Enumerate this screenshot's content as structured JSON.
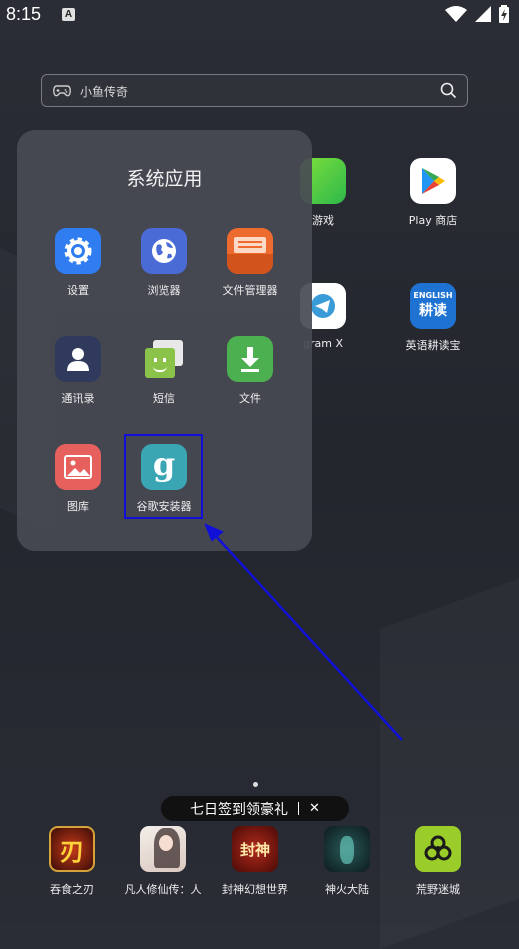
{
  "status_bar": {
    "time": "8:15",
    "notification_letter": "A"
  },
  "search": {
    "placeholder": "小鱼传奇"
  },
  "background_apps": [
    {
      "label": "游戏"
    },
    {
      "label": "Play 商店"
    },
    {
      "label": "gram X"
    },
    {
      "label": "英语耕读宝",
      "icon_line1": "ENGLISH",
      "icon_line2": "耕读"
    }
  ],
  "folder": {
    "title": "系统应用",
    "apps": [
      {
        "label": "设置"
      },
      {
        "label": "浏览器"
      },
      {
        "label": "文件管理器"
      },
      {
        "label": "通讯录"
      },
      {
        "label": "短信"
      },
      {
        "label": "文件"
      },
      {
        "label": "图库"
      },
      {
        "label": "谷歌安装器",
        "icon_letter": "g"
      }
    ]
  },
  "banner": {
    "text": "七日签到领豪礼",
    "close": "✕"
  },
  "dock": [
    {
      "label": "吞食之刃",
      "icon_text": "刃"
    },
    {
      "label": "凡人修仙传：人"
    },
    {
      "label": "封神幻想世界",
      "icon_text": "封神"
    },
    {
      "label": "神火大陆"
    },
    {
      "label": "荒野迷城"
    }
  ],
  "colors": {
    "highlight": "#1010d8",
    "arrow": "#1010d8",
    "folder_bg": "#484a54"
  }
}
